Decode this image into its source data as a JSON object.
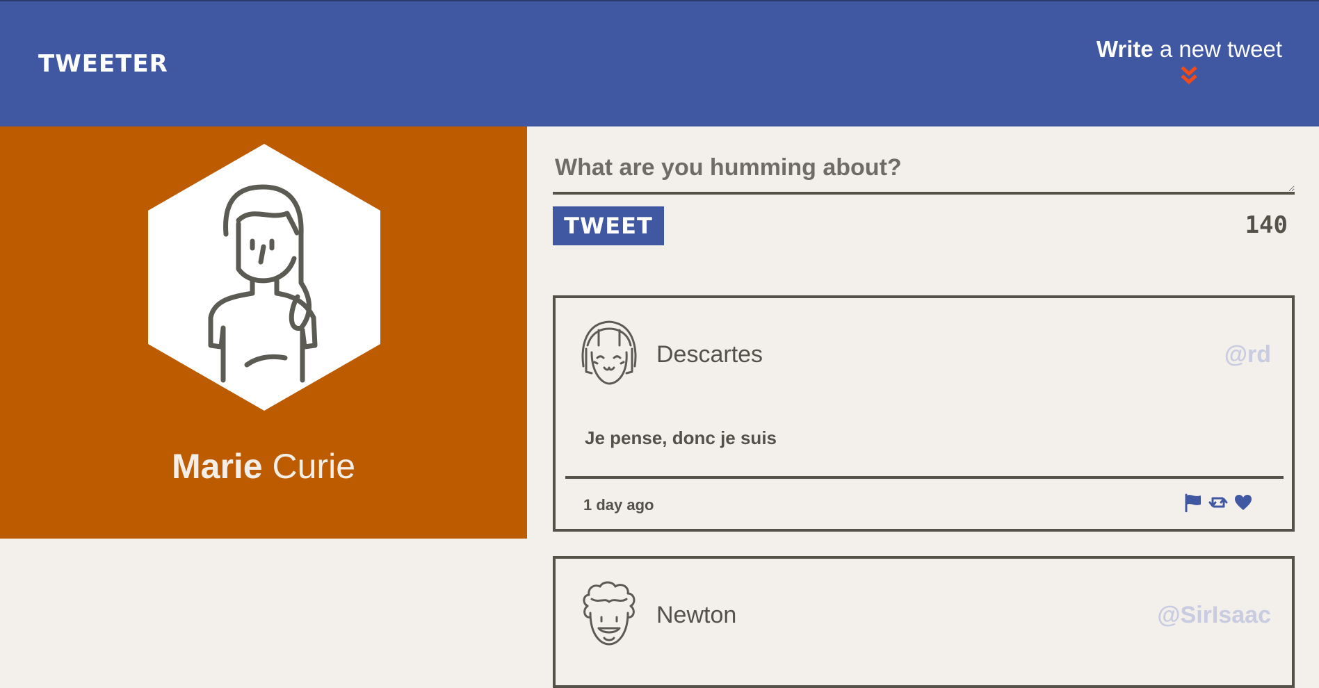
{
  "header": {
    "brand": "TWEETER",
    "compose_toggle": {
      "strong": "Write",
      "light": "a new tweet"
    },
    "chevron_icon": "double-chevron-down-icon"
  },
  "colors": {
    "header_bg": "#4057a2",
    "profile_bg": "#bc5b00",
    "page_bg": "#f3f0ec",
    "accent": "#f04b1a",
    "ink": "#545149",
    "handle": "#c9cbe0"
  },
  "profile": {
    "first_name": "Marie",
    "last_name": "Curie",
    "avatar_icon": "woman-avatar-icon"
  },
  "compose": {
    "placeholder": "What are you humming about?",
    "button_label": "TWEET",
    "counter": "140"
  },
  "tweets": [
    {
      "name": "Descartes",
      "handle": "@rd",
      "text": "Je pense, donc je suis",
      "time": "1 day ago",
      "avatar_icon": "girl-avatar-icon",
      "actions": [
        "flag-icon",
        "retweet-icon",
        "heart-icon"
      ]
    },
    {
      "name": "Newton",
      "handle": "@SirIsaac",
      "avatar_icon": "curly-hair-avatar-icon"
    }
  ]
}
